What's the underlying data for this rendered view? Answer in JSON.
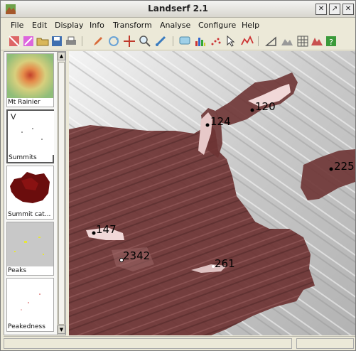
{
  "window": {
    "title": "Landserf 2.1"
  },
  "menu": [
    {
      "label": "File"
    },
    {
      "label": "Edit"
    },
    {
      "label": "Display"
    },
    {
      "label": "Info"
    },
    {
      "label": "Transform"
    },
    {
      "label": "Analyse"
    },
    {
      "label": "Configure"
    },
    {
      "label": "Help"
    }
  ],
  "sidebar": {
    "items": [
      {
        "label": "Mt Rainier"
      },
      {
        "label": "Summits",
        "preview_text": "V"
      },
      {
        "label": "Summit cat..."
      },
      {
        "label": "Peaks"
      },
      {
        "label": "Peakedness"
      }
    ]
  },
  "map": {
    "summits": [
      {
        "label": "120"
      },
      {
        "label": "124"
      },
      {
        "label": "225"
      },
      {
        "label": "147"
      },
      {
        "label": "2342"
      },
      {
        "label": "261"
      }
    ]
  },
  "colors": {
    "summit_fill": "#6e3434",
    "highlight": "#f1d8d8"
  }
}
